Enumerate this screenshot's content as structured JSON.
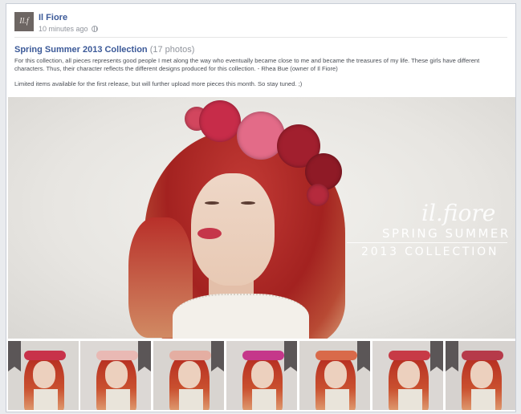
{
  "post": {
    "page_name": "Il Fiore",
    "avatar_text": "Il.f",
    "timestamp": "10 minutes ago",
    "privacy_icon": "globe-icon"
  },
  "album": {
    "title": "Spring Summer 2013 Collection",
    "count": "(17 photos)",
    "paragraph1": "For this collection, all pieces represents good people I met along the way who eventually became close to me and became the treasures of my life. These girls have different characters. Thus, their character reflects the different designs produced for this collection. - Rhea Bue (owner of Il Fiore)",
    "paragraph2": "Limited items available for the first release, but will further upload more pieces this month. So stay tuned. ;)"
  },
  "hero": {
    "logo_script": "il.fiore",
    "line1": "SPRING SUMMER",
    "line2": "2013 COLLECTION"
  },
  "thumbnails": [
    {
      "crown": "#c8324a",
      "bg": "#d9d6d2"
    },
    {
      "crown": "#e9b9b4",
      "bg": "#dcd8d5"
    },
    {
      "crown": "#e4aea2",
      "bg": "#d8d4d0"
    },
    {
      "crown": "#c5378a",
      "bg": "#dad6d3"
    },
    {
      "crown": "#d96a4a",
      "bg": "#d9d5d1"
    },
    {
      "crown": "#c73a46",
      "bg": "#dbd7d4"
    },
    {
      "crown": "#b63a4a",
      "bg": "#d6d2cf"
    }
  ],
  "colors": {
    "link": "#3b5998",
    "muted": "#90949c",
    "body_text": "#4b4f56"
  }
}
